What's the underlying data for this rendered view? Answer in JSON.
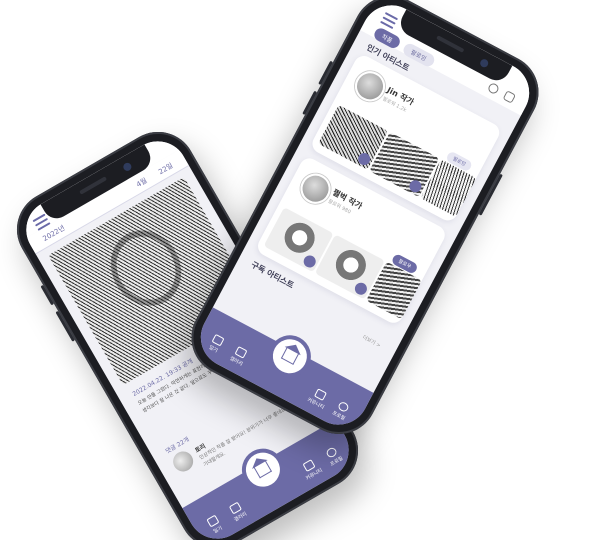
{
  "front": {
    "tabs": [
      {
        "label": "작품",
        "active": true
      },
      {
        "label": "팔로잉",
        "active": false
      }
    ],
    "popular_title": "인기 아티스트",
    "artists": [
      {
        "name": "Jin 작가",
        "sub": "팔로워 1.2k",
        "button": "팔로잉"
      },
      {
        "name": "쩔벅 작가",
        "sub": "팔로워 980",
        "button": "팔로우"
      }
    ],
    "subscribed_title": "구독 아티스트",
    "more_label": "더보기 >",
    "nav": [
      {
        "label": "일기",
        "icon": "diary-icon"
      },
      {
        "label": "갤러리",
        "icon": "gallery-icon"
      },
      {
        "label": "커뮤니티",
        "icon": "community-icon"
      },
      {
        "label": "프로필",
        "icon": "profile-icon"
      }
    ]
  },
  "back": {
    "year": "2022년",
    "month": "4월",
    "day": "22일",
    "post_date": "2022.04.22. 19:33 공개",
    "post_text": "오늘 만들 그렸다. 막연하게는 표현하고 싶은 마음에 그림을 그렸는데 생각보다 잘 나온 것 같다. 앞으로도 꾸준히 그려보고 싶다.",
    "comment_count": "댓글 22개",
    "comment_author": "토리",
    "comment_text": "인상적인 작품 잘 봤어요! 분위기가 너무 좋네요. 앞으로도 기대할게요.",
    "nav": [
      {
        "label": "일기",
        "icon": "diary-icon"
      },
      {
        "label": "갤러리",
        "icon": "gallery-icon"
      },
      {
        "label": "커뮤니티",
        "icon": "community-icon"
      },
      {
        "label": "프로필",
        "icon": "profile-icon"
      }
    ]
  },
  "colors": {
    "accent": "#6c6ba6",
    "screen_bg": "#f1f1f6",
    "phone_body": "#1c1d22"
  }
}
